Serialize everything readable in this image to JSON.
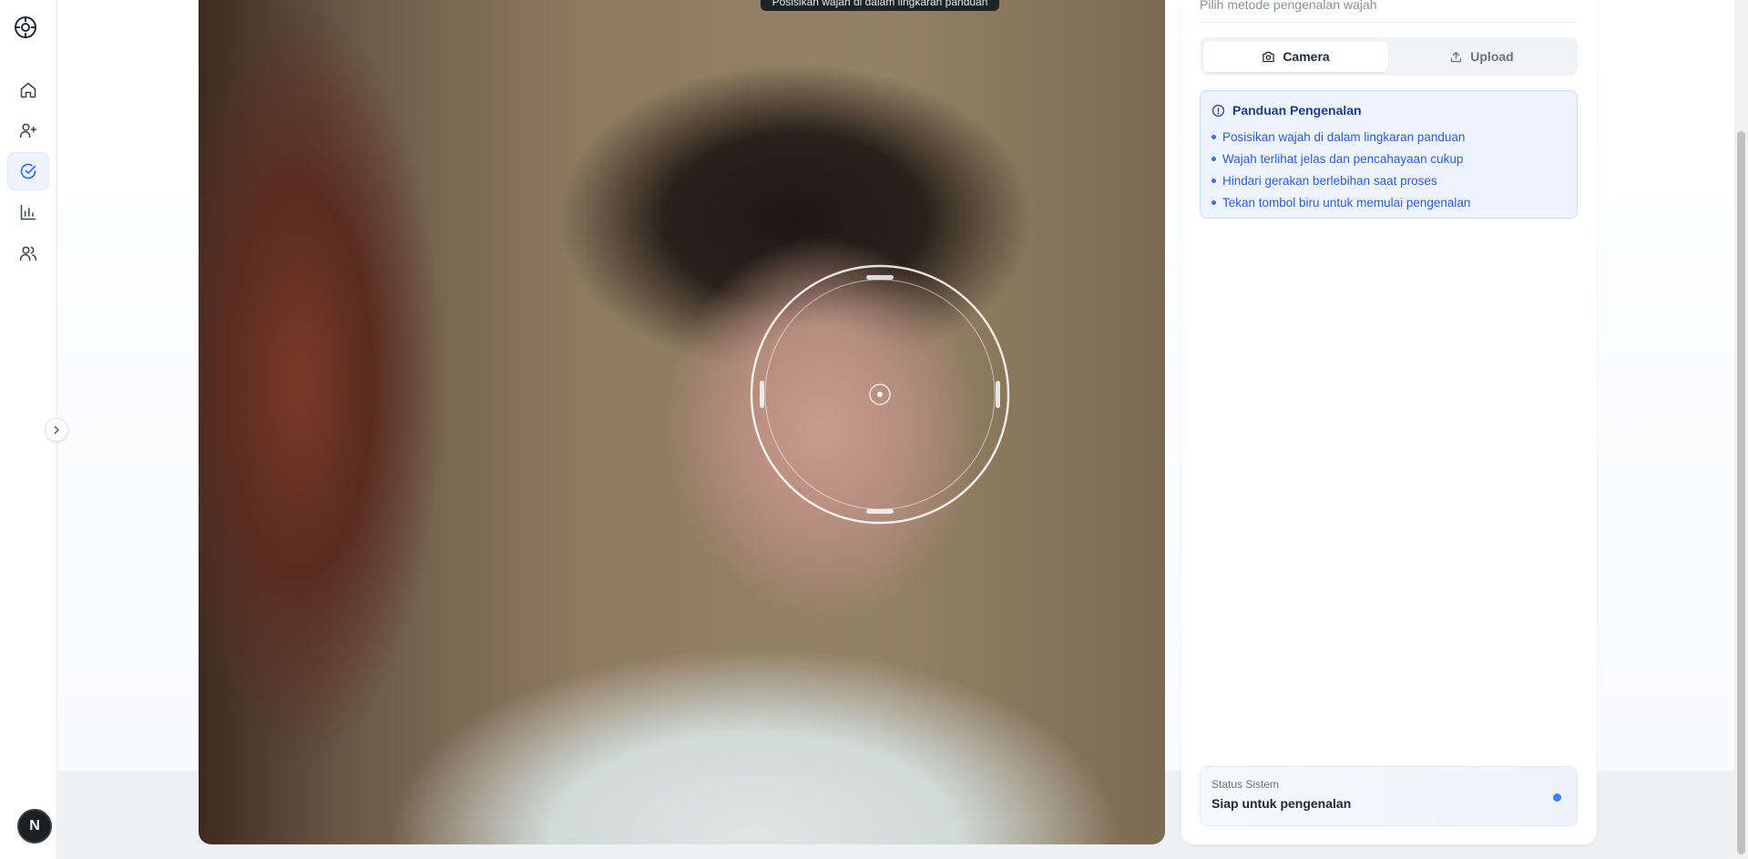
{
  "sidebar": {
    "logo_icon": "scan-logo-icon",
    "items": [
      {
        "name": "home",
        "icon": "home-icon",
        "active": false
      },
      {
        "name": "register",
        "icon": "user-plus-icon",
        "active": true
      },
      {
        "name": "recognize",
        "icon": "check-circle-icon",
        "active": true
      },
      {
        "name": "reports",
        "icon": "bar-chart-icon",
        "active": false
      },
      {
        "name": "users",
        "icon": "users-icon",
        "active": false
      }
    ],
    "avatar_initial": "N"
  },
  "camera": {
    "tooltip": "Posisikan wajah di dalam lingkaran panduan"
  },
  "panel": {
    "subtitle": "Pilih metode pengenalan wajah",
    "tabs": {
      "camera_label": "Camera",
      "upload_label": "Upload",
      "selected": "Camera"
    },
    "guide": {
      "title": "Panduan Pengenalan",
      "items": [
        "Posisikan wajah di dalam lingkaran panduan",
        "Wajah terlihat jelas dan pencahayaan cukup",
        "Hindari gerakan berlebihan saat proses",
        "Tekan tombol biru untuk memulai pengenalan"
      ]
    },
    "status": {
      "label": "Status Sistem",
      "value": "Siap untuk pengenalan",
      "indicator_color": "#3b82f6"
    }
  },
  "colors": {
    "accent": "#2f6fe4",
    "guide_bg": "#eef4ff",
    "guide_text": "#2f5bd0"
  }
}
